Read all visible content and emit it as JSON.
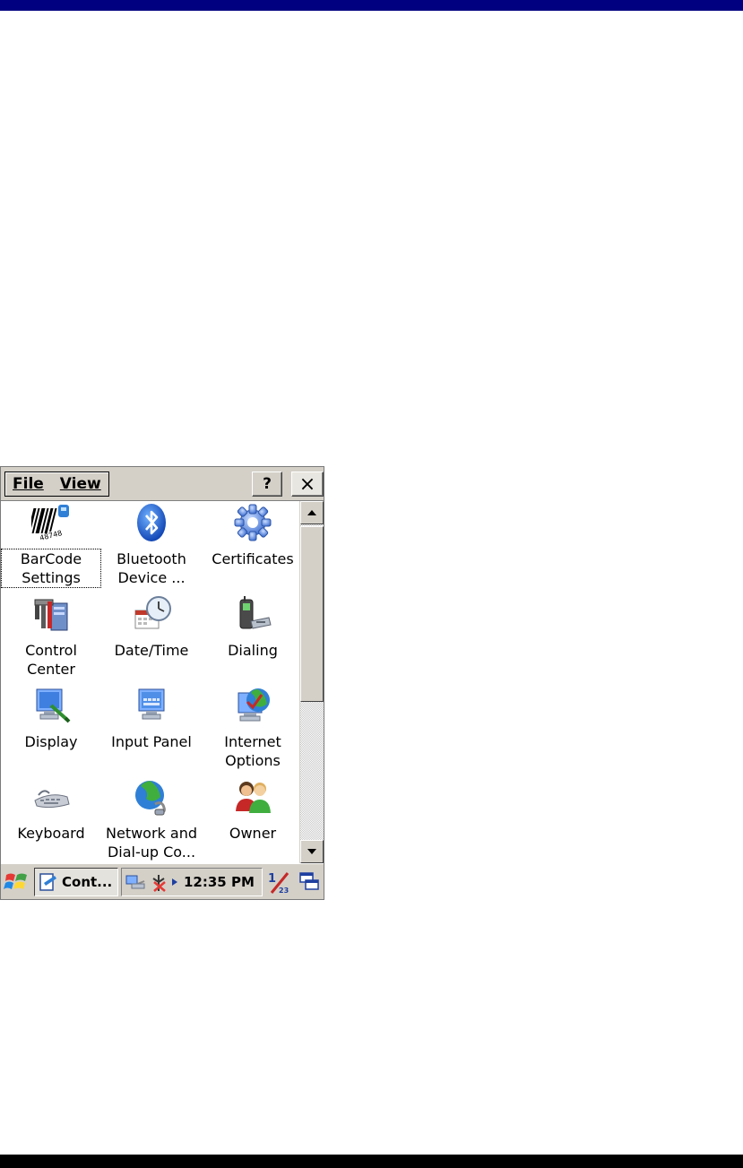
{
  "menubar": {
    "file_label": "File",
    "view_label": "View",
    "help_label": "?",
    "close_label": "×"
  },
  "items": [
    {
      "line1": "BarCode",
      "line2": "Settings",
      "icon": "barcode-icon"
    },
    {
      "line1": "Bluetooth",
      "line2": "Device ...",
      "icon": "bluetooth-icon"
    },
    {
      "line1": "Certificates",
      "line2": "",
      "icon": "certificates-gear-icon"
    },
    {
      "line1": "Control",
      "line2": "Center",
      "icon": "control-center-tools-icon"
    },
    {
      "line1": "Date/Time",
      "line2": "",
      "icon": "date-time-clock-icon"
    },
    {
      "line1": "Dialing",
      "line2": "",
      "icon": "dialing-phone-icon"
    },
    {
      "line1": "Display",
      "line2": "",
      "icon": "display-monitor-icon"
    },
    {
      "line1": "Input Panel",
      "line2": "",
      "icon": "input-panel-icon"
    },
    {
      "line1": "Internet",
      "line2": "Options",
      "icon": "internet-options-globe-icon"
    },
    {
      "line1": "Keyboard",
      "line2": "",
      "icon": "keyboard-icon"
    },
    {
      "line1": "Network and",
      "line2": "Dial-up Co...",
      "icon": "network-globe-icon"
    },
    {
      "line1": "Owner",
      "line2": "",
      "icon": "owner-people-icon"
    }
  ],
  "taskbar": {
    "task_label": "Cont...",
    "clock": "12:35 PM"
  },
  "colors": {
    "top_band": "#000080",
    "chrome": "#d4d0c8"
  }
}
